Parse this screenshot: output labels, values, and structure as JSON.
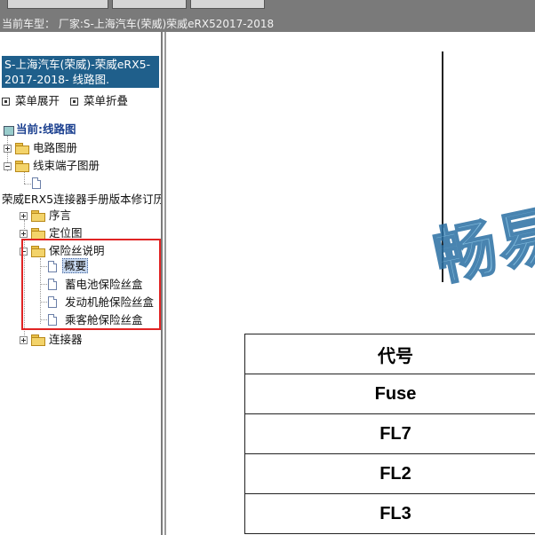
{
  "header": {
    "current_vehicle": "当前车型： 厂家:S-上海汽车(荣威)荣威eRX52017-2018"
  },
  "sidebar": {
    "title": "S-上海汽车(荣威)-荣威eRX5-2017-2018- 线路图.",
    "expand_label": "菜单展开",
    "collapse_label": "菜单折叠",
    "current_label": "当前:线路图",
    "tree": {
      "circuit_manual": "电路图册",
      "harness_manual": "线束端子图册",
      "connector_manual": "荣威ERX5连接器手册版本修订历",
      "preface": "序言",
      "location": "定位图",
      "fuse_desc": "保险丝说明",
      "overview": "概要",
      "battery_fuse": "蓄电池保险丝盒",
      "engine_fuse": "发动机舱保险丝盒",
      "cabin_fuse": "乘客舱保险丝盒",
      "connector": "连接器"
    }
  },
  "content": {
    "watermark": "畅易",
    "table": {
      "header": "代号",
      "rows": [
        "Fuse",
        "FL7",
        "FL2",
        "FL3"
      ]
    }
  }
}
